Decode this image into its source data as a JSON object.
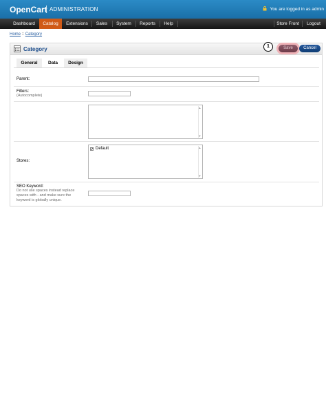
{
  "header": {
    "logo": "OpenCart",
    "subtitle": "ADMINISTRATION",
    "logged_in_text": "You are logged in as admin"
  },
  "menu": {
    "items": [
      {
        "label": "Dashboard"
      },
      {
        "label": "Catalog"
      },
      {
        "label": "Extensions"
      },
      {
        "label": "Sales"
      },
      {
        "label": "System"
      },
      {
        "label": "Reports"
      },
      {
        "label": "Help"
      }
    ],
    "right": [
      {
        "label": "Store Front"
      },
      {
        "label": "Logout"
      }
    ],
    "active": "Catalog"
  },
  "breadcrumb": {
    "home": "Home",
    "separator": " :: ",
    "current": "Category"
  },
  "box": {
    "title": "Category",
    "save_label": "Save",
    "cancel_label": "Cancel",
    "marker": "1"
  },
  "tabs": [
    {
      "label": "General"
    },
    {
      "label": "Data"
    },
    {
      "label": "Design"
    }
  ],
  "selected_tab": "Data",
  "form": {
    "parent_label": "Parent:",
    "parent_value": "",
    "filters_label": "Filters:",
    "filters_help": "(Autocomplete)",
    "filters_value": "",
    "stores_label": "Stores:",
    "stores_options": [
      {
        "label": "Default",
        "checked": true
      }
    ],
    "seo_label": "SEO Keyword:",
    "seo_help": "Do not use spaces instead replace spaces with - and make sure the keyword is globally unique.",
    "seo_value": ""
  },
  "colors": {
    "header_blue": "#1a6fa8",
    "menu_active": "#d05a17",
    "title_blue": "#1a4b8a",
    "cancel_blue": "#103d74",
    "save_highlight": "#f0b3b8"
  }
}
